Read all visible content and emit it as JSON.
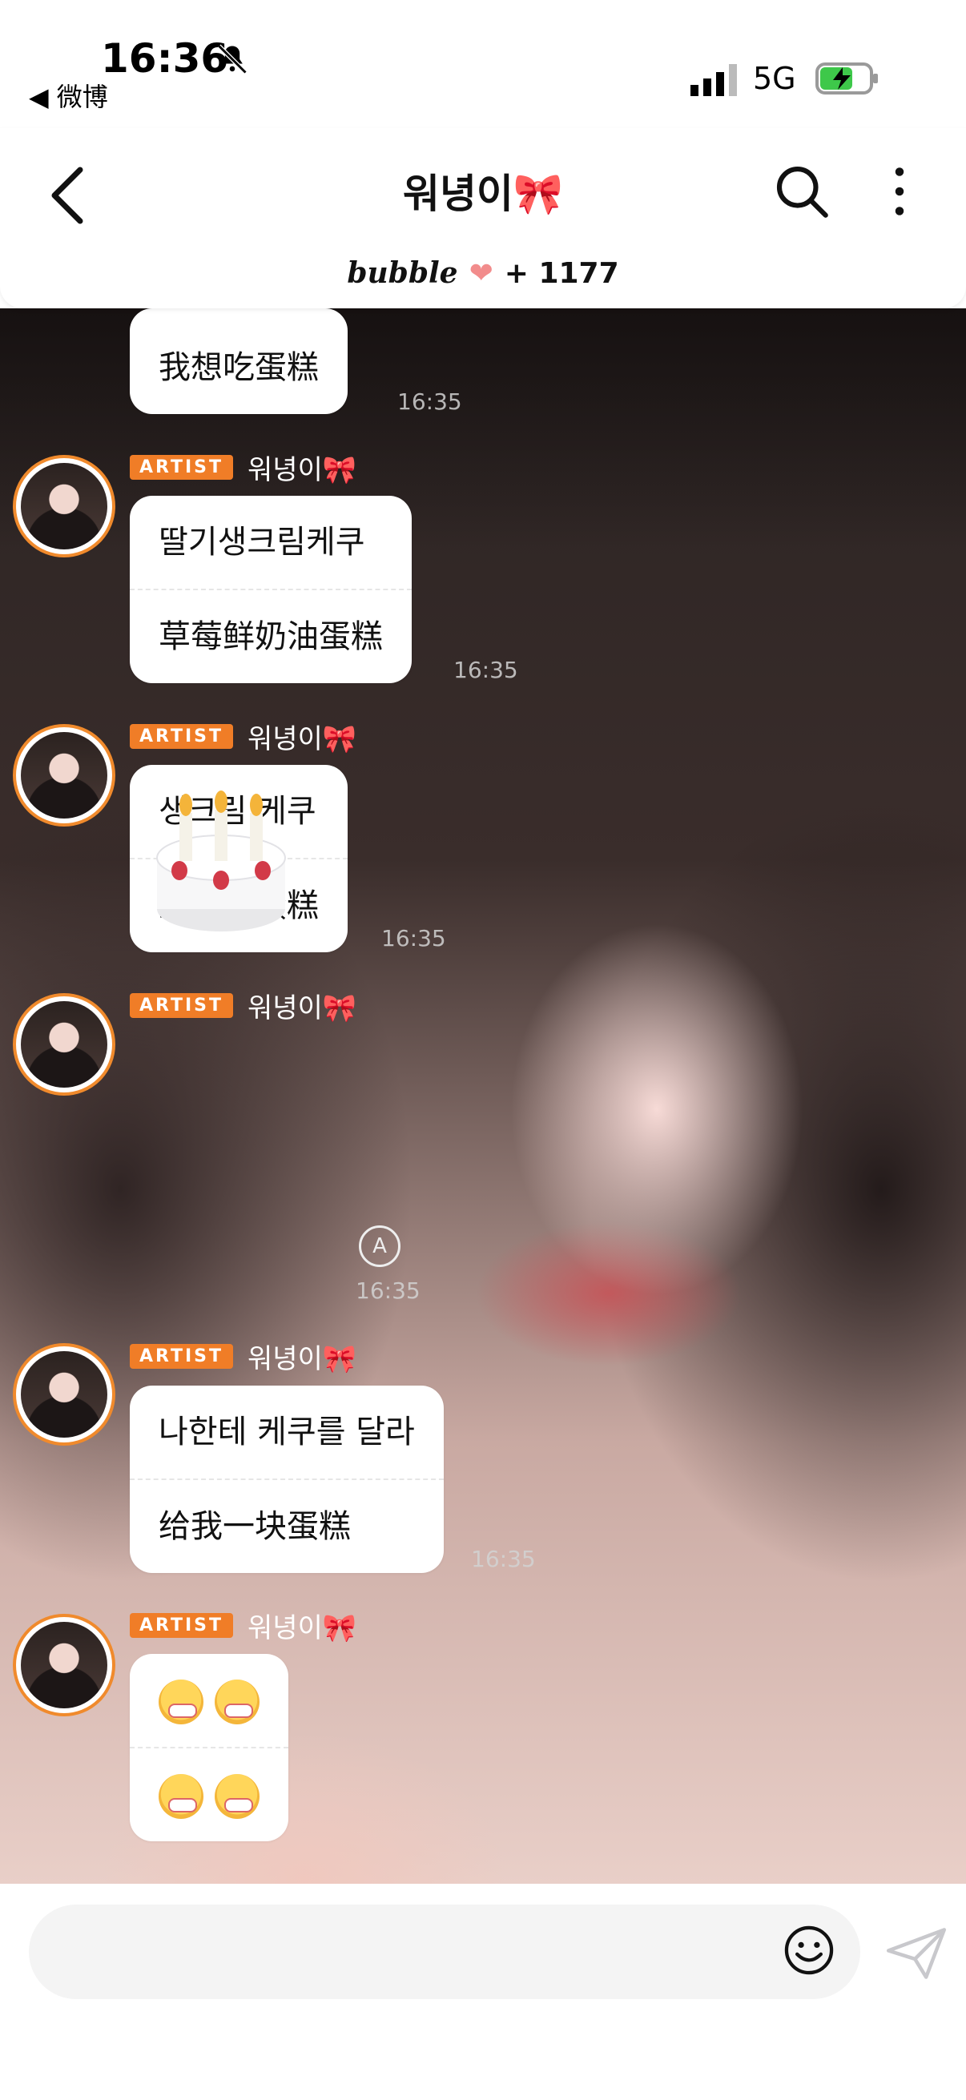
{
  "status_bar": {
    "time": "16:36",
    "back_app": "◀ 微博",
    "network": "5G"
  },
  "header": {
    "title": "워녕이🎀",
    "brand": "bubble",
    "heart": "❤",
    "count": "+ 1177"
  },
  "messages": [
    {
      "lines": [
        "我想吃蛋糕"
      ],
      "time": "16:35"
    },
    {
      "sender": "워녕이🎀",
      "badge": "ARTIST",
      "lines": [
        "딸기생크림케쿠",
        "草莓鲜奶油蛋糕"
      ],
      "time": "16:35"
    },
    {
      "sender": "워녕이🎀",
      "badge": "ARTIST",
      "lines": [
        "생크림 케쿠",
        "鲜奶油蛋糕"
      ],
      "time": "16:35"
    },
    {
      "sender": "워녕이🎀",
      "badge": "ARTIST",
      "sticker": "cake",
      "time": "16:35"
    },
    {
      "sender": "워녕이🎀",
      "badge": "ARTIST",
      "lines": [
        "나한테 케쿠를 달라",
        "给我一块蛋糕"
      ],
      "time": "16:35"
    },
    {
      "sender": "워녕이🎀",
      "badge": "ARTIST",
      "emoji_lines": 2
    }
  ],
  "colors": {
    "artist_badge": "#f07d27",
    "avatar_ring": "#f08a2c"
  }
}
